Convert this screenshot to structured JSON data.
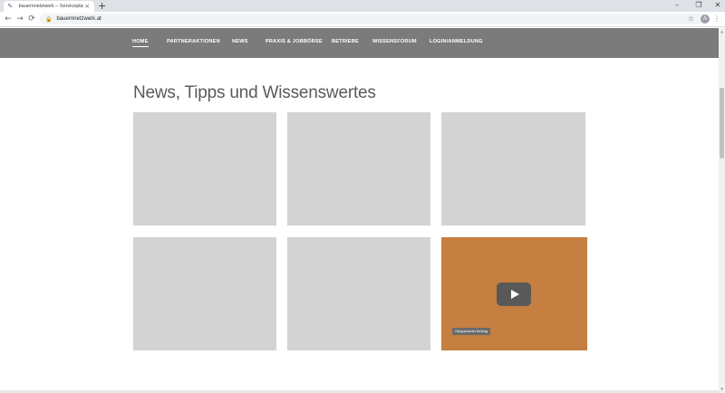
{
  "browser": {
    "tab_title": "bauernnetzwerk – Serviceplattfo",
    "favicon": "✎",
    "close_glyph": "×",
    "new_tab_glyph": "+",
    "url": "bauernnetzwerk.at",
    "avatar_letter": "A",
    "window_controls": {
      "minimize": "–",
      "restore": "❐",
      "close": "✕"
    },
    "nav_glyphs": {
      "back": "←",
      "forward": "→",
      "reload": "⟳"
    },
    "lock_glyph": "🔒",
    "star_glyph": "☆",
    "menu_glyph": "⋮"
  },
  "site_nav": {
    "items": [
      {
        "label": "HOME"
      },
      {
        "label": "PARTNERAKTIONEN"
      },
      {
        "label": "NEWS"
      },
      {
        "label": "PRAXIS & JOBBÖRSE"
      },
      {
        "label": "BETRIEBE"
      },
      {
        "label": "WISSENSFORUM"
      },
      {
        "label": "LOGIN/ANMELDUNG"
      }
    ]
  },
  "main": {
    "title": "News, Tipps und Wissenswertes",
    "video_card": {
      "badge": "Gesponserter Beitrag",
      "color": "#c57f40"
    }
  },
  "colors": {
    "nav_bg": "#7b7b7b",
    "card_placeholder": "#d3d3d3",
    "title": "#5a5a5a"
  }
}
